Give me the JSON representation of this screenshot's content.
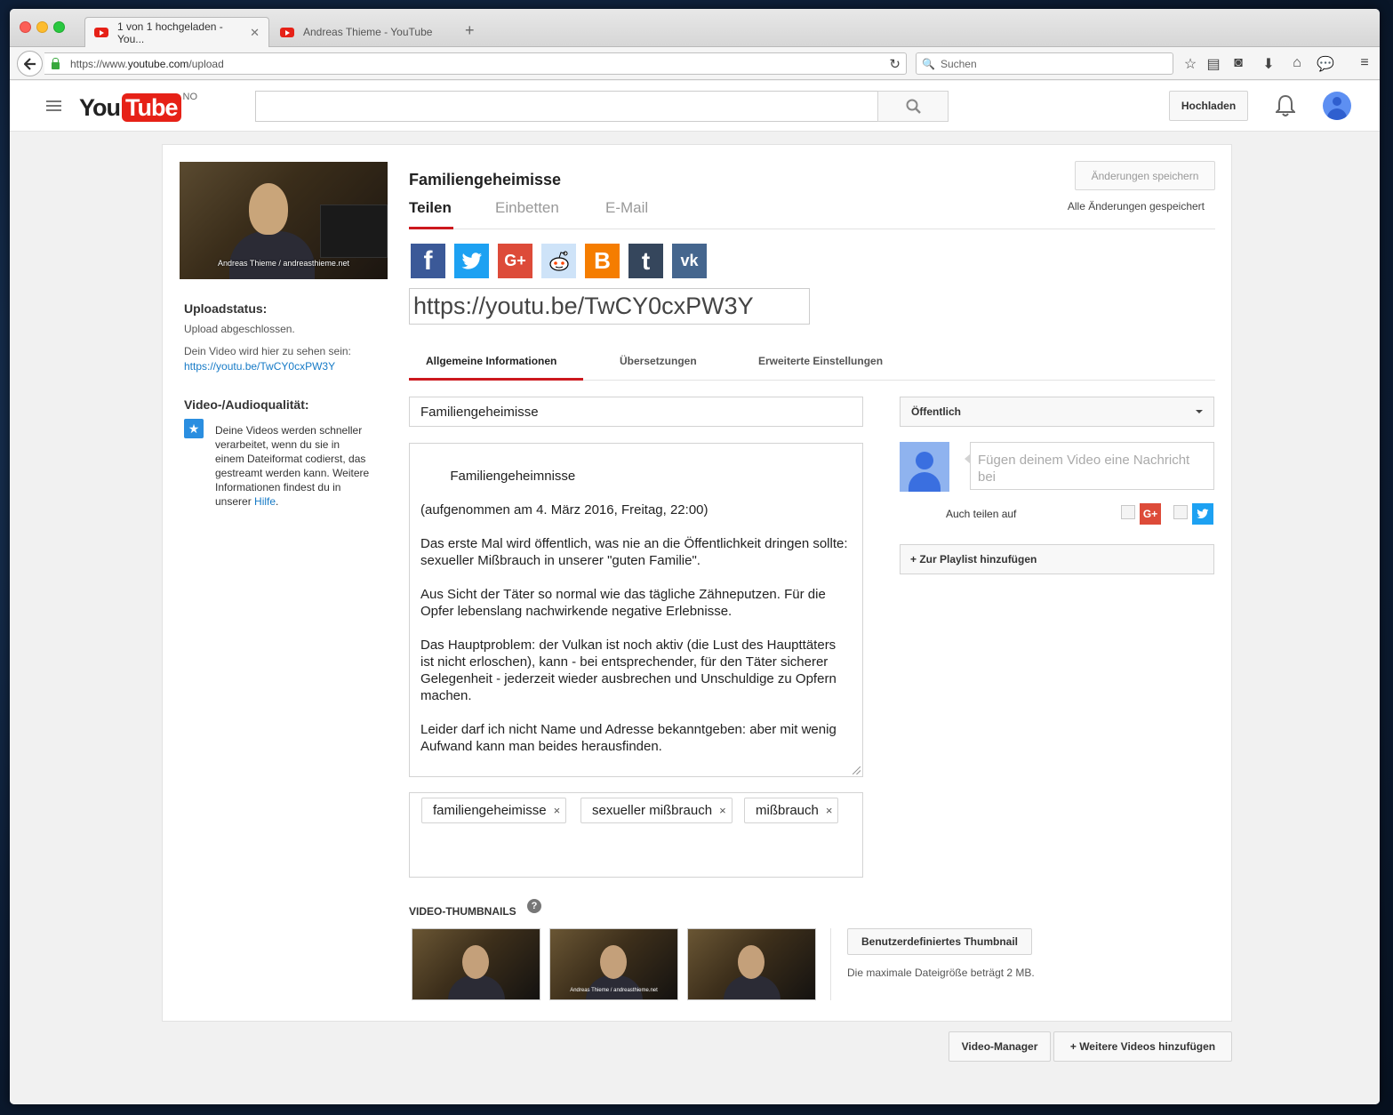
{
  "browser": {
    "tabs": [
      {
        "title": "1 von 1 hochgeladen - You...",
        "close": "✕"
      },
      {
        "title": "Andreas Thieme - YouTube",
        "close": ""
      }
    ],
    "new_tab": "+",
    "url_prefix": "https://www.",
    "url_domain": "youtube.com",
    "url_path": "/upload",
    "reload_icon": "↻",
    "search_placeholder": "Suchen"
  },
  "header": {
    "logo_you": "You",
    "logo_tube": "Tube",
    "country_code": "NO",
    "search_value": "",
    "upload_button": "Hochladen"
  },
  "sidebar": {
    "thumb_watermark": "Andreas Thieme / andreasthieme.net",
    "upload_status_heading": "Uploadstatus:",
    "upload_status_text": "Upload abgeschlossen.",
    "video_visible_text": "Dein Video wird hier zu sehen sein:",
    "video_link": "https://youtu.be/TwCY0cxPW3Y",
    "quality_heading": "Video-/Audioqualität:",
    "quality_text": "Deine Videos werden schneller verarbeitet, wenn du sie in einem Dateiformat codierst, das gestreamt werden kann. Weitere Informationen findest du in unserer ",
    "quality_link": "Hilfe",
    "quality_end": "."
  },
  "main": {
    "video_title": "Familiengeheimisse",
    "save_button": "Änderungen speichern",
    "saved_status": "Alle Änderungen gespeichert",
    "share_tabs": [
      "Teilen",
      "Einbetten",
      "E-Mail"
    ],
    "social": [
      {
        "name": "facebook",
        "glyph": "f",
        "color": "#3b5998"
      },
      {
        "name": "twitter",
        "glyph": "🐦",
        "color": "#1da1f2"
      },
      {
        "name": "google-plus",
        "glyph": "G+",
        "color": "#dd4b39"
      },
      {
        "name": "reddit",
        "glyph": "👽",
        "color": "#cee3f8"
      },
      {
        "name": "blogger",
        "glyph": "B",
        "color": "#f57d00"
      },
      {
        "name": "tumblr",
        "glyph": "t",
        "color": "#35465c"
      },
      {
        "name": "vk",
        "glyph": "vk",
        "color": "#45668e"
      }
    ],
    "share_url": "https://youtu.be/TwCY0cxPW3Y",
    "info_tabs": [
      "Allgemeine Informationen",
      "Übersetzungen",
      "Erweiterte Einstellungen"
    ],
    "title_field": "Familiengeheimisse",
    "description": "Familiengeheimnisse\n\n(aufgenommen am 4. März 2016, Freitag, 22:00)\n\nDas erste Mal wird öffentlich, was nie an die Öffentlichkeit dringen sollte: sexueller Mißbrauch in unserer \"guten Familie\".\n\nAus Sicht der Täter so normal wie das tägliche Zähneputzen. Für die Opfer lebenslang nachwirkende negative Erlebnisse.\n\nDas Hauptproblem: der Vulkan ist noch aktiv (die Lust des Haupttäters ist nicht erloschen), kann - bei entsprechender, für den Täter sicherer Gelegenheit - jederzeit wieder ausbrechen und Unschuldige zu Opfern machen.\n\nLeider darf ich nicht Name und Adresse bekanntgeben: aber mit wenig Aufwand kann man beides herausfinden.",
    "tags": [
      "familiengeheimisse",
      "sexueller mißbrauch",
      "mißbrauch"
    ],
    "tag_remove": "×",
    "privacy": "Öffentlich",
    "message_placeholder": "Fügen deinem Video eine Nachricht bei",
    "also_share": "Auch teilen auf",
    "playlist_button": "+ Zur Playlist hinzufügen",
    "thumbnails_label": "VIDEO-THUMBNAILS",
    "help_glyph": "?",
    "thumb_watermark_small": "Andreas Thieme / andreasthieme.net",
    "custom_thumb_button": "Benutzerdefiniertes Thumbnail",
    "max_size_text": "Die maximale Dateigröße beträgt 2 MB."
  },
  "footer": {
    "video_manager": "Video-Manager",
    "add_more": "+ Weitere Videos hinzufügen"
  },
  "colors": {
    "accent_red": "#cc181e",
    "link_blue": "#167ac6"
  }
}
